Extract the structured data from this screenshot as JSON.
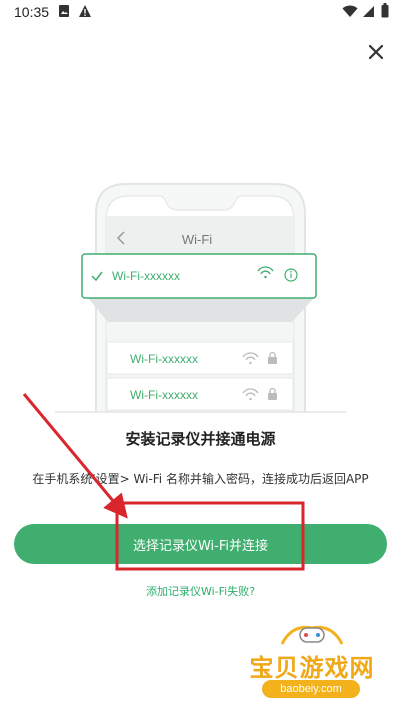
{
  "status_bar": {
    "time": "10:35",
    "icons": [
      "photo-icon",
      "warning-icon",
      "wifi-icon",
      "signal-icon",
      "battery-icon"
    ]
  },
  "illustration": {
    "screen_title": "Wi-Fi",
    "selected_network": "Wi-Fi-xxxxxx",
    "networks": [
      "Wi-Fi-xxxxxx",
      "Wi-Fi-xxxxxx"
    ],
    "accent_color": "#3fae6e"
  },
  "content": {
    "title": "安装记录仪并接通电源",
    "description": "在手机系统'设置> Wi-Fi 名称并输入密码，连接成功后返回APP",
    "primary_button": "选择记录仪Wi-Fi并连接",
    "fail_link": "添加记录仪Wi-Fi失败?"
  },
  "watermark": {
    "title": "宝贝游戏网",
    "subtitle": "baobeiy.com"
  },
  "annotation_color": "#d9262c"
}
